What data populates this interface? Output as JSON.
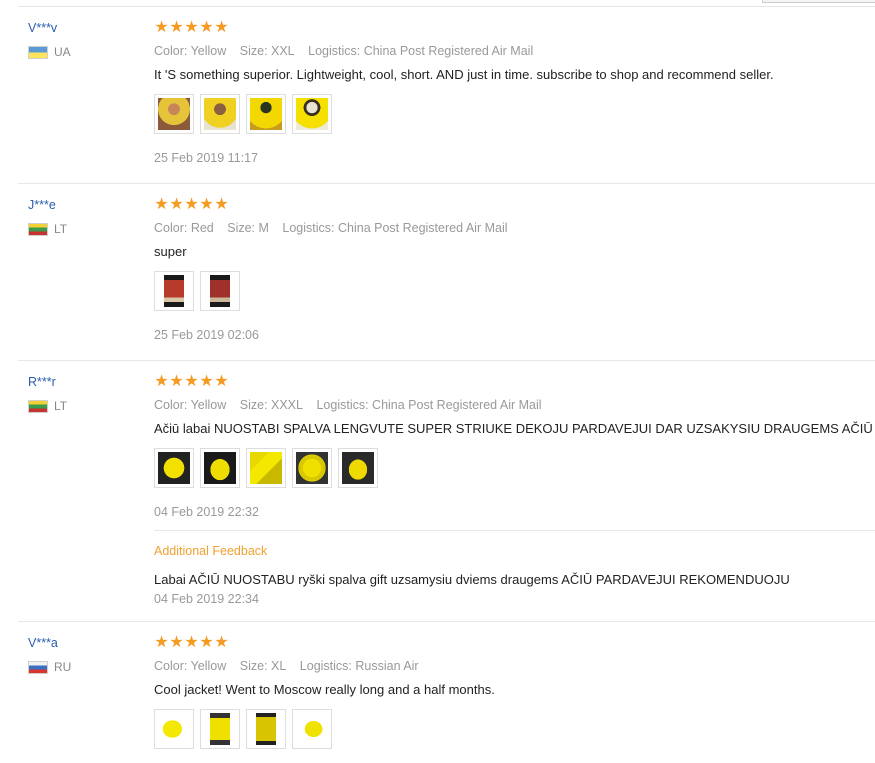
{
  "reviews": [
    {
      "buyer": "V***v",
      "country_code": "UA",
      "flag": "ua",
      "rating_label": "★★★★★",
      "color": "Color: Yellow",
      "size": "Size: XXL",
      "logistics": "Logistics: China Post Registered Air Mail",
      "text": "It 'S something superior. Lightweight, cool, short. AND just in time. subscribe to shop and recommend seller.",
      "photos": 4,
      "date": "25 Feb 2019 11:17"
    },
    {
      "buyer": "J***e",
      "country_code": "LT",
      "flag": "lt",
      "rating_label": "★★★★★",
      "color": "Color: Red",
      "size": "Size: M",
      "logistics": "Logistics: China Post Registered Air Mail",
      "text": "super",
      "photos": 2,
      "date": "25 Feb 2019 02:06"
    },
    {
      "buyer": "R***r",
      "country_code": "LT",
      "flag": "lt",
      "rating_label": "★★★★★",
      "color": "Color: Yellow",
      "size": "Size: XXXL",
      "logistics": "Logistics: China Post Registered Air Mail",
      "text": "Ačiū labai NUOSTABI SPALVA LENGVUTE SUPER STRIUKE DEKOJU PARDAVEJUI DAR UZSAKYSIU DRAUGEMS AČIŪ",
      "photos": 5,
      "date": "04 Feb 2019 22:32",
      "additional": {
        "label": "Additional Feedback",
        "text": "Labai AČIŪ NUOSTABU ryški spalva gift uzsamysiu dviems draugems AČIŪ PARDAVEJUI REKOMENDUOJU",
        "date": "04 Feb 2019 22:34"
      }
    },
    {
      "buyer": "V***a",
      "country_code": "RU",
      "flag": "ru",
      "rating_label": "★★★★★",
      "color": "Color: Yellow",
      "size": "Size: XL",
      "logistics": "Logistics: Russian Air",
      "text": "Cool jacket! Went to Moscow really long and a half months.",
      "photos": 4,
      "date": ""
    }
  ],
  "colors": {
    "buyer_link": "#2a5db0",
    "star": "#f59a23",
    "meta": "#999999",
    "additional_label": "#f0a030"
  }
}
